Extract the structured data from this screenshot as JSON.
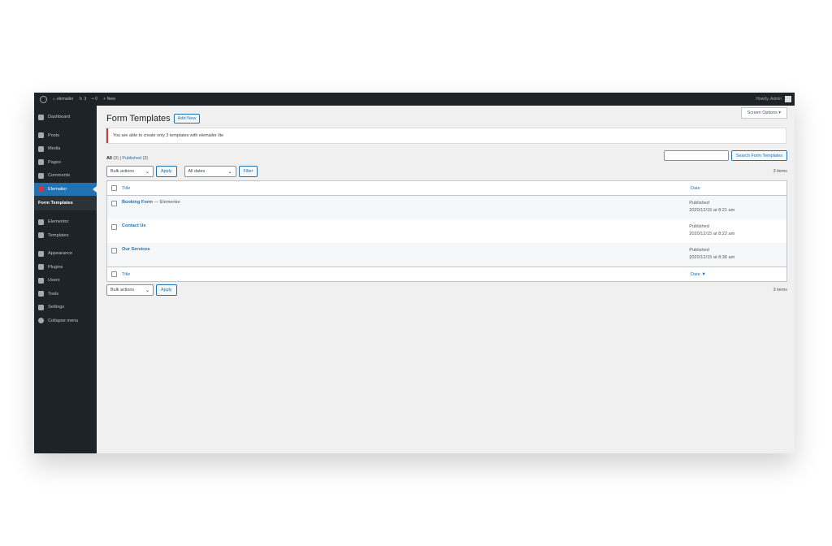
{
  "adminbar": {
    "site_name": "elemailer",
    "updates_count": "3",
    "comments_count": "0",
    "new_label": "New",
    "howdy": "Howdy, Admin"
  },
  "sidebar": {
    "items": [
      {
        "label": "Dashboard",
        "icon": "dashboard-icon"
      },
      {
        "label": "Posts",
        "icon": "pin-icon"
      },
      {
        "label": "Media",
        "icon": "media-icon"
      },
      {
        "label": "Pages",
        "icon": "page-icon"
      },
      {
        "label": "Comments",
        "icon": "comment-icon"
      }
    ],
    "active": {
      "label": "Elemailer",
      "icon": "elemailer-icon",
      "submenu": "Form Templates"
    },
    "items2": [
      {
        "label": "Elementor",
        "icon": "elementor-icon"
      },
      {
        "label": "Templates",
        "icon": "folder-icon"
      }
    ],
    "items3": [
      {
        "label": "Appearance",
        "icon": "brush-icon"
      },
      {
        "label": "Plugins",
        "icon": "plugin-icon"
      },
      {
        "label": "Users",
        "icon": "users-icon"
      },
      {
        "label": "Tools",
        "icon": "wrench-icon"
      },
      {
        "label": "Settings",
        "icon": "settings-icon"
      },
      {
        "label": "Collapse menu",
        "icon": "collapse-icon"
      }
    ]
  },
  "header": {
    "screen_options": "Screen Options ▾",
    "title": "Form Templates",
    "add_new": "Add New"
  },
  "notice": "You are able to create only 3 templates with elemailer lite",
  "views": {
    "all_label": "All",
    "all_count": "(3)",
    "separator": "|",
    "published_label": "Published",
    "published_count": "(3)"
  },
  "search": {
    "button": "Search Form Templates",
    "value": ""
  },
  "tablenav_top": {
    "bulk": "Bulk actions",
    "apply": "Apply",
    "dates": "All dates",
    "filter": "Filter",
    "items": "3 items"
  },
  "table": {
    "col_title": "Title",
    "col_date": "Date",
    "col_date_footer": "Date ▼",
    "rows": [
      {
        "title": "Booking Form",
        "suffix": " — Elementor",
        "status": "Published",
        "date": "2020/12/15 at 8:21 am"
      },
      {
        "title": "Contact Us",
        "suffix": "",
        "status": "Published",
        "date": "2020/12/15 at 8:22 am"
      },
      {
        "title": "Our Services",
        "suffix": "",
        "status": "Published",
        "date": "2020/12/15 at 8:36 am"
      }
    ]
  },
  "tablenav_bottom": {
    "bulk": "Bulk actions",
    "apply": "Apply",
    "items": "3 items"
  },
  "colors": {
    "admin_bg": "#1d2327",
    "accent": "#2271b1",
    "notice_border": "#d63638"
  }
}
